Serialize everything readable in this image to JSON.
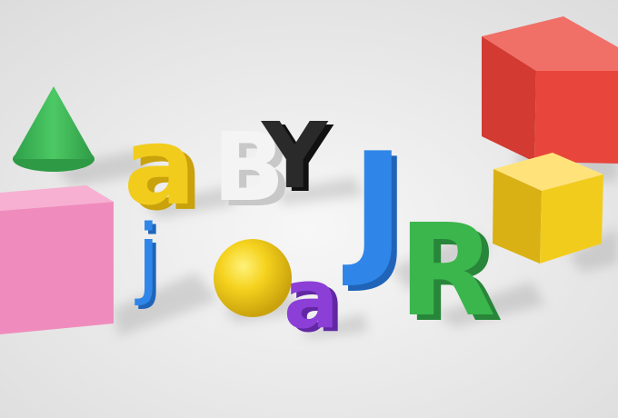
{
  "scene": {
    "objects": [
      {
        "name": "green-cone",
        "color": "#3dbb5a"
      },
      {
        "name": "pink-cube",
        "color": "#f08cbd"
      },
      {
        "name": "yellow-letter",
        "text": "a",
        "color": "#f2cc1d"
      },
      {
        "name": "blue-letter",
        "text": "j",
        "color": "#2f86e8"
      },
      {
        "name": "white-letter",
        "text": "B",
        "color": "#f4f4f4"
      },
      {
        "name": "black-letter",
        "text": "Y",
        "color": "#2a2a2a"
      },
      {
        "name": "blue-letter",
        "text": "J",
        "color": "#2f86e8"
      },
      {
        "name": "green-letter",
        "text": "R",
        "color": "#3bb64c"
      },
      {
        "name": "yellow-sphere",
        "color": "#f2cc1d"
      },
      {
        "name": "purple-letter",
        "text": "a",
        "color": "#8b3fd6"
      },
      {
        "name": "red-cube",
        "color": "#e8453c"
      },
      {
        "name": "yellow-cube",
        "color": "#f2cc1d"
      }
    ]
  }
}
